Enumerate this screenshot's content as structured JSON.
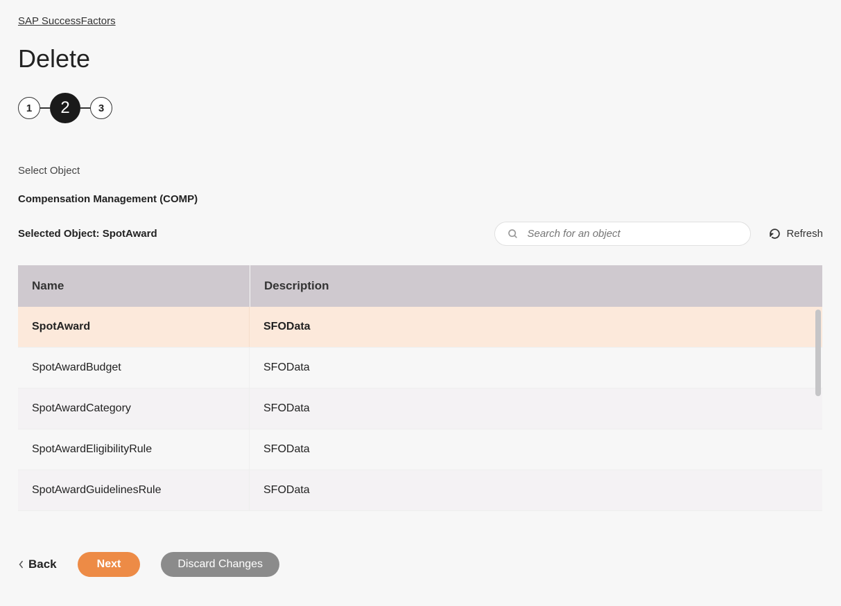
{
  "breadcrumb": "SAP SuccessFactors",
  "page_title": "Delete",
  "stepper": {
    "steps": [
      "1",
      "2",
      "3"
    ],
    "active_index": 1
  },
  "section_label": "Select Object",
  "module_label": "Compensation Management (COMP)",
  "selected_label": "Selected Object: SpotAward",
  "search": {
    "placeholder": "Search for an object"
  },
  "refresh_label": "Refresh",
  "table": {
    "headers": {
      "name": "Name",
      "description": "Description"
    },
    "rows": [
      {
        "name": "SpotAward",
        "description": "SFOData",
        "selected": true
      },
      {
        "name": "SpotAwardBudget",
        "description": "SFOData",
        "selected": false
      },
      {
        "name": "SpotAwardCategory",
        "description": "SFOData",
        "selected": false
      },
      {
        "name": "SpotAwardEligibilityRule",
        "description": "SFOData",
        "selected": false
      },
      {
        "name": "SpotAwardGuidelinesRule",
        "description": "SFOData",
        "selected": false
      }
    ]
  },
  "footer": {
    "back": "Back",
    "next": "Next",
    "discard": "Discard Changes"
  }
}
